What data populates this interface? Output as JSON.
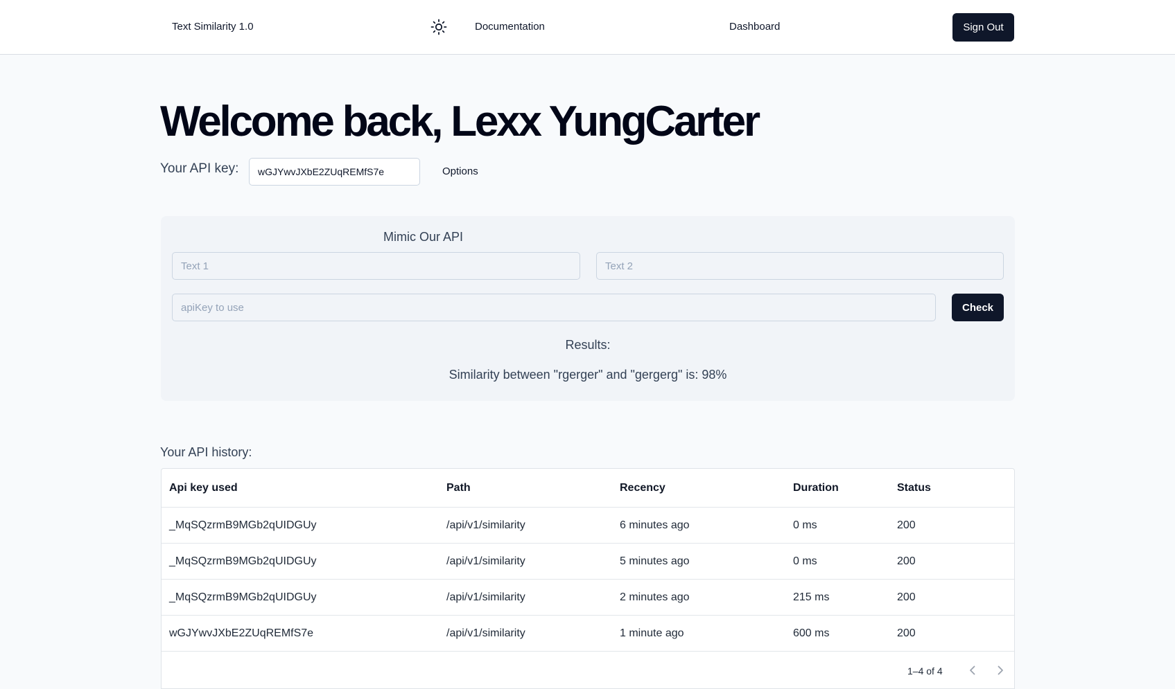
{
  "nav": {
    "brand": "Text Similarity 1.0",
    "theme_icon": "sun-icon",
    "docs_label": "Documentation",
    "dashboard_label": "Dashboard",
    "signout_label": "Sign Out"
  },
  "header": {
    "welcome": "Welcome back, Lexx YungCarter",
    "apikey_label": "Your API key:",
    "apikey_value": "wGJYwvJXbE2ZUqREMfS7e",
    "options_label": "Options"
  },
  "mimic": {
    "title": "Mimic Our API",
    "text1_placeholder": "Text 1",
    "text2_placeholder": "Text 2",
    "apikey_placeholder": "apiKey to use",
    "check_label": "Check",
    "results_label": "Results:",
    "similarity_text": "Similarity between \"rgerger\" and \"gergerg\" is: 98%"
  },
  "history": {
    "label": "Your API history:",
    "columns": [
      "Api key used",
      "Path",
      "Recency",
      "Duration",
      "Status"
    ],
    "rows": [
      [
        "_MqSQzrmB9MGb2qUIDGUy",
        "/api/v1/similarity",
        "6 minutes ago",
        "0 ms",
        "200"
      ],
      [
        "_MqSQzrmB9MGb2qUIDGUy",
        "/api/v1/similarity",
        "5 minutes ago",
        "0 ms",
        "200"
      ],
      [
        "_MqSQzrmB9MGb2qUIDGUy",
        "/api/v1/similarity",
        "2 minutes ago",
        "215 ms",
        "200"
      ],
      [
        "wGJYwvJXbE2ZUqREMfS7e",
        "/api/v1/similarity",
        "1 minute ago",
        "600 ms",
        "200"
      ]
    ],
    "pagination": "1–4 of 4",
    "prev_icon": "chevron-left-icon",
    "next_icon": "chevron-right-icon"
  }
}
